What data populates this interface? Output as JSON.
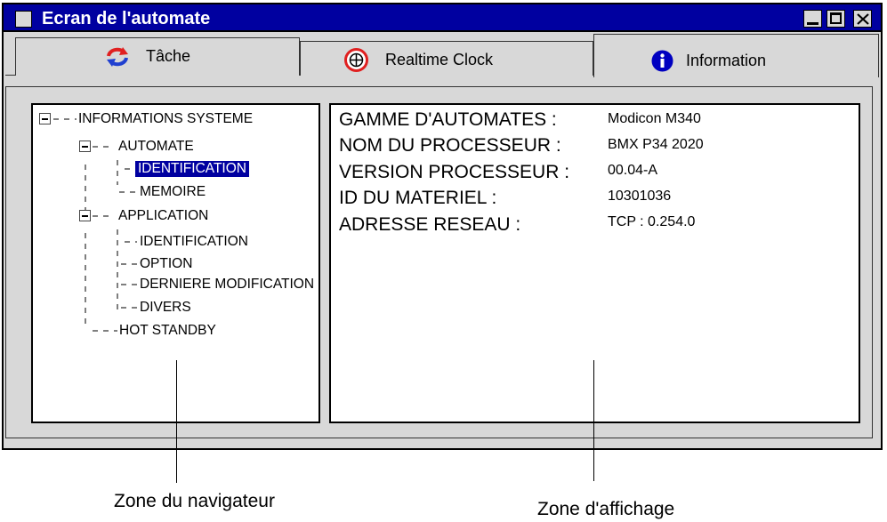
{
  "window": {
    "title": "Ecran de l'automate"
  },
  "tabs": [
    {
      "label": "Tâche",
      "icon": "refresh-arrows-icon"
    },
    {
      "label": "Realtime Clock",
      "icon": "clock-icon"
    },
    {
      "label": "Information",
      "icon": "info-icon",
      "active": true
    }
  ],
  "tree": {
    "root": "INFORMATIONS SYSTEME",
    "automate": "AUTOMATE",
    "automate_identification": "IDENTIFICATION",
    "memoire": "MEMOIRE",
    "application": "APPLICATION",
    "app_identification": "IDENTIFICATION",
    "option": "OPTION",
    "derniere_modification": "DERNIERE MODIFICATION",
    "divers": "DIVERS",
    "hot_standby": "HOT STANDBY",
    "selected": "IDENTIFICATION"
  },
  "info": [
    {
      "label": "GAMME D'AUTOMATES :",
      "value": "Modicon M340"
    },
    {
      "label": "NOM DU PROCESSEUR :",
      "value": "BMX P34 2020"
    },
    {
      "label": "VERSION PROCESSEUR :",
      "value": "00.04-A"
    },
    {
      "label": "ID DU MATERIEL :",
      "value": "10301036"
    },
    {
      "label": "ADRESSE RESEAU :",
      "value": "TCP : 0.254.0"
    }
  ],
  "annotations": {
    "navigator": "Zone du navigateur",
    "display": "Zone d'affichage"
  },
  "colors": {
    "titlebar": "#0000a0",
    "window_bg": "#d8d8d8",
    "selection": "#0000a0",
    "info_icon": "#0000c0",
    "tache_icon_red": "#e02020",
    "tache_icon_blue": "#2040d0",
    "clock_icon": "#e02020"
  }
}
